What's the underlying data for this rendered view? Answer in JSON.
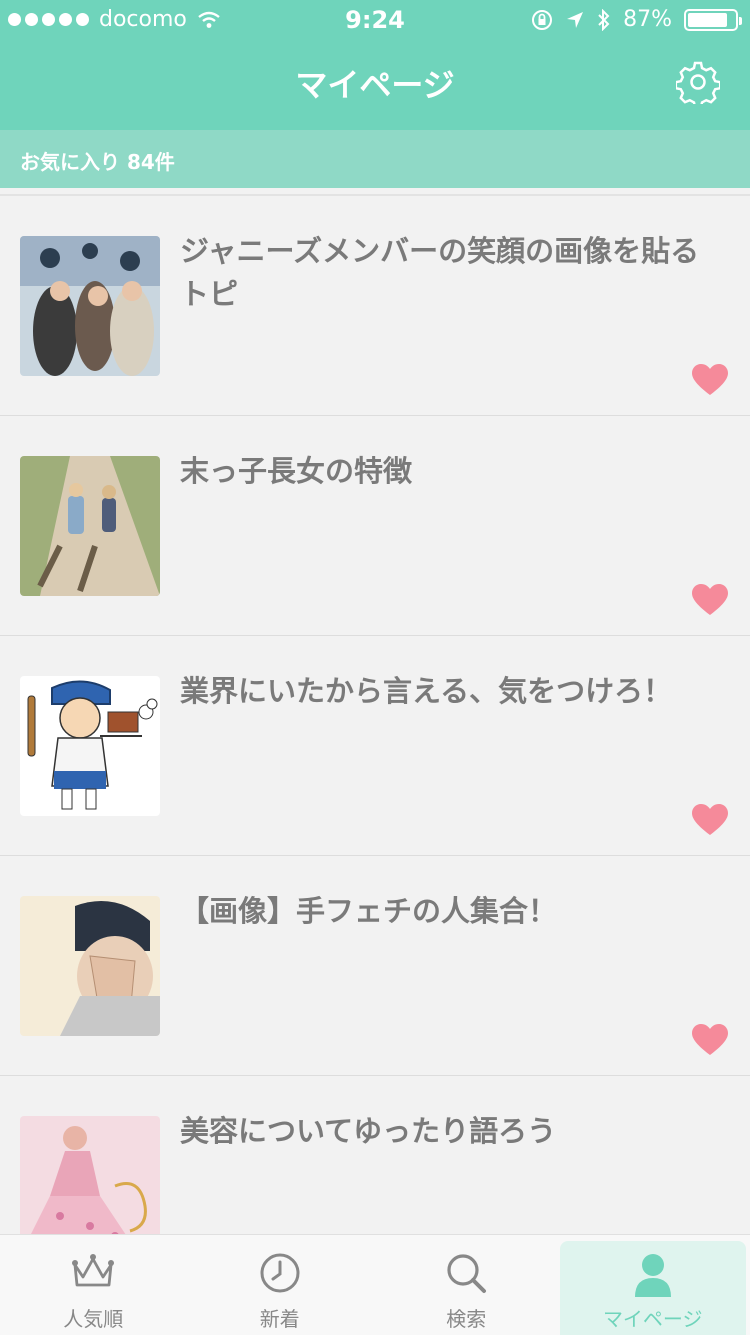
{
  "status_bar": {
    "carrier": "docomo",
    "time": "9:24",
    "battery": "87%"
  },
  "header": {
    "title": "マイページ",
    "settings_icon": "gear-icon"
  },
  "subheader": {
    "label": "お気に入り 84件"
  },
  "favorites": [
    {
      "title": "ジャニーズメンバーの笑顔の画像を貼るトピ",
      "thumb": "group-photo"
    },
    {
      "title": "末っ子長女の特徴",
      "thumb": "children-walking"
    },
    {
      "title": "業界にいたから言える、気をつけろ！",
      "thumb": "baker-illustration"
    },
    {
      "title": "【画像】手フェチの人集合！",
      "thumb": "hand-over-face"
    },
    {
      "title": "美容についてゆったり語ろう",
      "thumb": "pink-dress"
    }
  ],
  "tabbar": {
    "tabs": [
      {
        "label": "人気順",
        "icon": "crown-icon"
      },
      {
        "label": "新着",
        "icon": "clock-icon"
      },
      {
        "label": "検索",
        "icon": "search-icon"
      },
      {
        "label": "マイページ",
        "icon": "user-icon",
        "active": true
      }
    ]
  },
  "colors": {
    "accent": "#6fd4bb",
    "heart": "#f58a9a",
    "text": "#7a7a7a"
  }
}
